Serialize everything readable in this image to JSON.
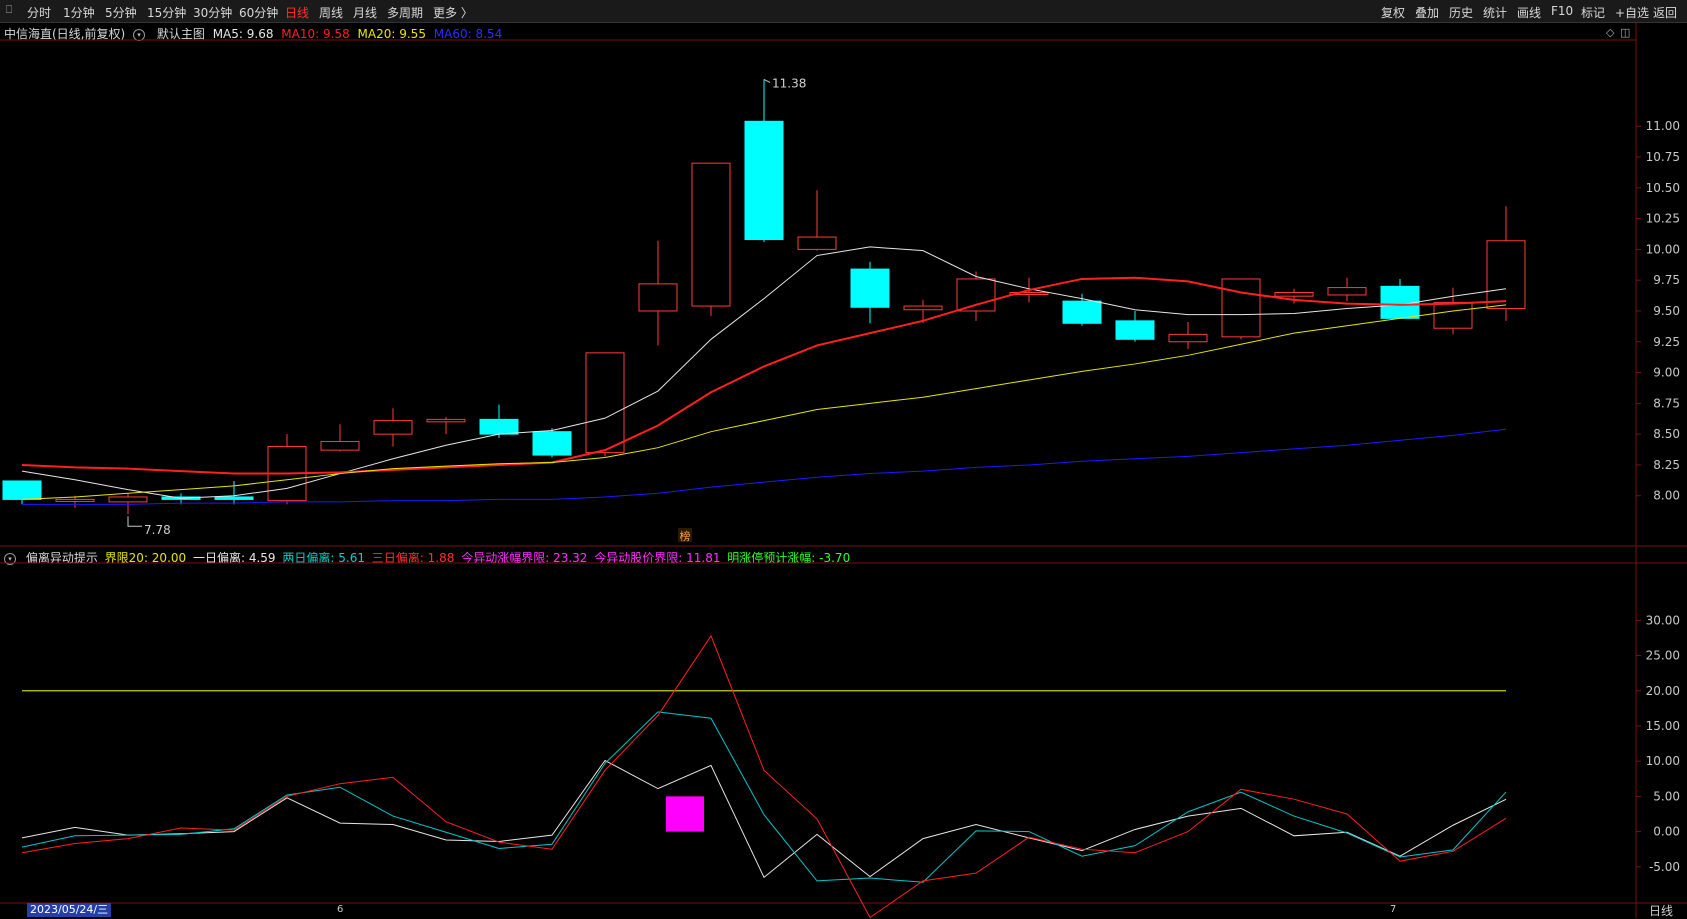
{
  "toolbar": {
    "periods": [
      "分时",
      "1分钟",
      "5分钟",
      "15分钟",
      "30分钟",
      "60分钟",
      "日线",
      "周线",
      "月线",
      "多周期",
      "更多 〉"
    ],
    "active_period": "日线",
    "right_buttons": [
      "复权",
      "叠加",
      "历史",
      "统计",
      "画线",
      "F10",
      "标记",
      "+自选",
      "返回"
    ]
  },
  "main_info": {
    "stock": "中信海直(日线,前复权)",
    "template": "默认主图",
    "ma5": "MA5: 9.68",
    "ma10": "MA10: 9.58",
    "ma20": "MA20: 9.55",
    "ma60": "MA60: 8.54"
  },
  "sub_info": {
    "name": "偏离异动提示",
    "limit20": "界限20: 20.00",
    "one_day": "一日偏离: 4.59",
    "two_day": "两日偏离: 5.61",
    "three_day": "三日偏离: 1.88",
    "today_limit": "今异动涨幅界限: 23.32",
    "today_price": "今异动股价界限: 11.81",
    "tomorrow": "明涨停预计涨幅: -3.70"
  },
  "colors": {
    "up": "#ff3b3b",
    "down": "#00ffff",
    "ma5": "#e6e6e6",
    "ma10": "#ff2020",
    "ma20": "#e6e600",
    "ma60": "#1a1aff",
    "limit": "#cccc00",
    "alert": "#ff00ff"
  },
  "chart_data": [
    {
      "type": "candlestick",
      "dates_visible": [
        "2023/05/24/三"
      ],
      "x_ticks": [
        "6",
        "7"
      ],
      "ylim": [
        7.6,
        11.7
      ],
      "y_ticks": [
        "8.00",
        "8.25",
        "8.50",
        "8.75",
        "9.00",
        "9.25",
        "9.50",
        "9.75",
        "10.00",
        "10.25",
        "10.50",
        "10.75",
        "11.00"
      ],
      "annotations": {
        "high": "11.38",
        "low": "7.78",
        "marker": "榜"
      },
      "candles": [
        {
          "o": 8.12,
          "c": 7.97,
          "h": 8.12,
          "l": 7.93
        },
        {
          "o": 7.97,
          "c": 7.97,
          "h": 8.0,
          "l": 7.9
        },
        {
          "o": 7.95,
          "c": 7.99,
          "h": 8.02,
          "l": 7.85
        },
        {
          "o": 7.99,
          "c": 7.97,
          "h": 8.02,
          "l": 7.93
        },
        {
          "o": 7.99,
          "c": 7.97,
          "h": 8.12,
          "l": 7.93
        },
        {
          "o": 7.96,
          "c": 8.4,
          "h": 8.5,
          "l": 7.93
        },
        {
          "o": 8.37,
          "c": 8.44,
          "h": 8.58,
          "l": 8.36
        },
        {
          "o": 8.5,
          "c": 8.61,
          "h": 8.71,
          "l": 8.4
        },
        {
          "o": 8.6,
          "c": 8.62,
          "h": 8.64,
          "l": 8.5
        },
        {
          "o": 8.62,
          "c": 8.5,
          "h": 8.74,
          "l": 8.47
        },
        {
          "o": 8.52,
          "c": 8.33,
          "h": 8.55,
          "l": 8.31
        },
        {
          "o": 8.35,
          "c": 9.16,
          "h": 9.16,
          "l": 8.32
        },
        {
          "o": 9.5,
          "c": 9.72,
          "h": 10.07,
          "l": 9.22
        },
        {
          "o": 9.54,
          "c": 10.7,
          "h": 10.7,
          "l": 9.46
        },
        {
          "o": 11.04,
          "c": 10.08,
          "h": 11.38,
          "l": 10.06
        },
        {
          "o": 10.0,
          "c": 10.1,
          "h": 10.48,
          "l": 9.99
        },
        {
          "o": 9.84,
          "c": 9.53,
          "h": 9.9,
          "l": 9.4
        },
        {
          "o": 9.51,
          "c": 9.54,
          "h": 9.59,
          "l": 9.4
        },
        {
          "o": 9.5,
          "c": 9.76,
          "h": 9.82,
          "l": 9.42
        },
        {
          "o": 9.64,
          "c": 9.65,
          "h": 9.77,
          "l": 9.57
        },
        {
          "o": 9.58,
          "c": 9.4,
          "h": 9.64,
          "l": 9.38
        },
        {
          "o": 9.42,
          "c": 9.27,
          "h": 9.5,
          "l": 9.25
        },
        {
          "o": 9.25,
          "c": 9.31,
          "h": 9.41,
          "l": 9.19
        },
        {
          "o": 9.29,
          "c": 9.76,
          "h": 9.76,
          "l": 9.27
        },
        {
          "o": 9.62,
          "c": 9.65,
          "h": 9.68,
          "l": 9.56
        },
        {
          "o": 9.63,
          "c": 9.69,
          "h": 9.77,
          "l": 9.58
        },
        {
          "o": 9.7,
          "c": 9.44,
          "h": 9.76,
          "l": 9.44
        },
        {
          "o": 9.36,
          "c": 9.57,
          "h": 9.69,
          "l": 9.31
        },
        {
          "o": 9.52,
          "c": 10.07,
          "h": 10.35,
          "l": 9.42
        }
      ],
      "ma_series": [
        {
          "name": "MA5",
          "values": [
            8.2,
            8.13,
            8.05,
            7.98,
            8.0,
            8.06,
            8.18,
            8.3,
            8.41,
            8.5,
            8.53,
            8.63,
            8.85,
            9.27,
            9.6,
            9.95,
            10.02,
            9.99,
            9.78,
            9.68,
            9.6,
            9.51,
            9.47,
            9.47,
            9.48,
            9.52,
            9.55,
            9.62,
            9.68
          ]
        },
        {
          "name": "MA10",
          "values": [
            8.25,
            8.23,
            8.22,
            8.2,
            8.18,
            8.18,
            8.19,
            8.21,
            8.23,
            8.25,
            8.27,
            8.37,
            8.57,
            8.84,
            9.05,
            9.22,
            9.32,
            9.42,
            9.55,
            9.67,
            9.76,
            9.77,
            9.74,
            9.65,
            9.59,
            9.56,
            9.55,
            9.56,
            9.58
          ]
        },
        {
          "name": "MA20",
          "values": [
            7.97,
            7.99,
            8.02,
            8.05,
            8.08,
            8.13,
            8.18,
            8.22,
            8.24,
            8.26,
            8.27,
            8.31,
            8.39,
            8.52,
            8.61,
            8.7,
            8.75,
            8.8,
            8.87,
            8.94,
            9.01,
            9.07,
            9.14,
            9.23,
            9.32,
            9.38,
            9.44,
            9.5,
            9.55
          ]
        },
        {
          "name": "MA60",
          "values": [
            7.93,
            7.93,
            7.93,
            7.94,
            7.94,
            7.95,
            7.95,
            7.96,
            7.96,
            7.97,
            7.97,
            7.99,
            8.02,
            8.07,
            8.11,
            8.15,
            8.18,
            8.2,
            8.23,
            8.25,
            8.28,
            8.3,
            8.32,
            8.35,
            8.38,
            8.41,
            8.45,
            8.49,
            8.54
          ]
        }
      ]
    },
    {
      "type": "line",
      "ylim": [
        -10,
        38
      ],
      "y_ticks": [
        "30.00",
        "25.00",
        "20.00",
        "15.00",
        "10.00",
        "5.00",
        "0.00",
        "-5.00"
      ],
      "limit": 20,
      "alert_bar": {
        "index": 12,
        "value": 5.0
      },
      "series": [
        {
          "name": "一日偏离",
          "values": [
            -0.9,
            0.6,
            -0.5,
            -0.3,
            0.0,
            4.8,
            1.2,
            1.0,
            -1.2,
            -1.4,
            -0.5,
            10.1,
            6.1,
            9.4,
            -6.5,
            -0.4,
            -6.4,
            -1.0,
            1.0,
            -0.9,
            -2.7,
            0.3,
            2.2,
            3.3,
            -0.6,
            -0.1,
            -3.5,
            0.9,
            4.59
          ]
        },
        {
          "name": "两日偏离",
          "values": [
            -2.2,
            -0.6,
            -0.5,
            -0.4,
            0.4,
            5.2,
            6.3,
            2.2,
            -0.1,
            -2.4,
            -1.8,
            9.7,
            17.0,
            16.1,
            2.4,
            -7.0,
            -6.6,
            -7.2,
            0.1,
            0.0,
            -3.5,
            -2.0,
            2.8,
            5.6,
            2.2,
            -0.2,
            -3.6,
            -2.6,
            5.61
          ]
        },
        {
          "name": "三日偏离",
          "values": [
            -3.0,
            -1.7,
            -1.0,
            0.5,
            0.2,
            5.0,
            6.8,
            7.7,
            1.4,
            -1.5,
            -2.5,
            8.7,
            16.5,
            27.8,
            8.7,
            1.8,
            -12.2,
            -7.0,
            -5.9,
            -0.8,
            -2.5,
            -3.0,
            0.0,
            6.0,
            4.6,
            2.5,
            -4.2,
            -2.8,
            1.88
          ]
        }
      ]
    }
  ]
}
